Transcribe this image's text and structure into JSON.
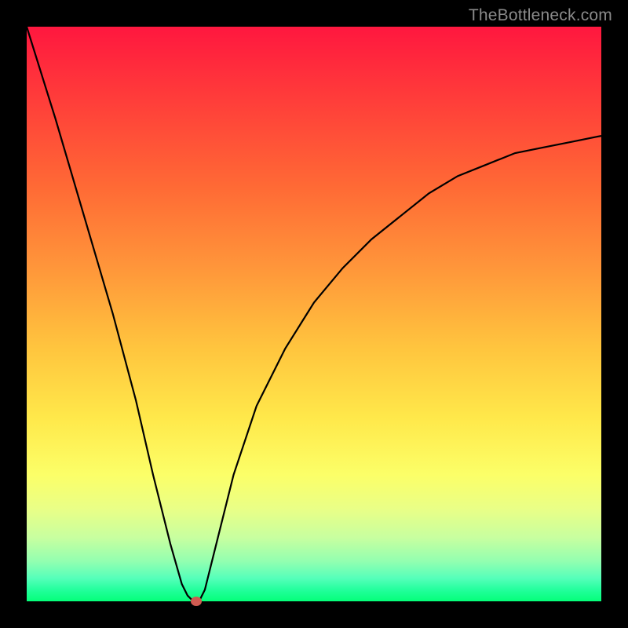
{
  "watermark": "TheBottleneck.com",
  "colors": {
    "frame": "#000000",
    "gradient_top": "#ff173f",
    "gradient_bottom": "#04ff79",
    "curve_stroke": "#000000",
    "marker_fill": "#cf5b51"
  },
  "chart_data": {
    "type": "line",
    "title": "",
    "xlabel": "",
    "ylabel": "",
    "xlim": [
      0,
      100
    ],
    "ylim": [
      0,
      100
    ],
    "grid": false,
    "series": [
      {
        "name": "bottleneck-curve",
        "x": [
          0,
          5,
          10,
          15,
          19,
          22,
          25,
          27,
          28,
          29,
          30,
          31,
          33,
          36,
          40,
          45,
          50,
          55,
          60,
          65,
          70,
          75,
          80,
          85,
          90,
          95,
          100
        ],
        "values": [
          100,
          84,
          67,
          50,
          35,
          22,
          10,
          3,
          1,
          0,
          0,
          2,
          10,
          22,
          34,
          44,
          52,
          58,
          63,
          67,
          71,
          74,
          76,
          78,
          79,
          80,
          81
        ]
      }
    ],
    "marker": {
      "x": 29.5,
      "y": 0
    },
    "notes": "Axis values are normalized 0-100 because the source image has no visible axis ticks or labels; values are estimated from pixel positions relative to the plot area."
  }
}
